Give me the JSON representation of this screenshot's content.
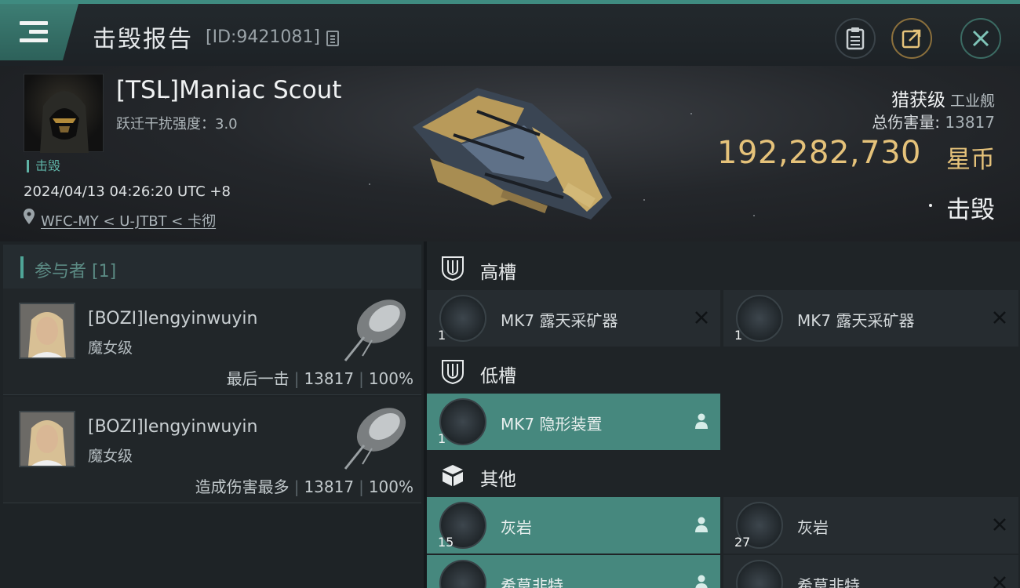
{
  "header": {
    "title": "击毁报告",
    "report_id": "[ID:9421081]"
  },
  "victim": {
    "name": "[TSL]Maniac Scout",
    "warp_disruption": "跃迁干扰强度：3.0",
    "status_tag": "击毁",
    "timestamp": "2024/04/13 04:26:20 UTC +8",
    "location": "WFC-MY < U-JTBT < 卡彻",
    "ship_class": "猎获级",
    "ship_type": "工业舰",
    "total_damage_label": "总伤害量:",
    "total_damage_value": "13817",
    "value": "192,282,730",
    "value_unit": "星币",
    "result": "击毁"
  },
  "participants": {
    "header": "参与者 [1]",
    "rows": [
      {
        "name": "[BOZI]lengyinwuyin",
        "ship": "魔女级",
        "role": "最后一击",
        "damage": "13817",
        "percent": "100%"
      },
      {
        "name": "[BOZI]lengyinwuyin",
        "ship": "魔女级",
        "role": "造成伤害最多",
        "damage": "13817",
        "percent": "100%"
      }
    ]
  },
  "fitting": {
    "high_label": "高槽",
    "low_label": "低槽",
    "other_label": "其他",
    "high": [
      {
        "name": "MK7 露天采矿器",
        "qty": "1",
        "state": "destroyed"
      },
      {
        "name": "MK7 露天采矿器",
        "qty": "1",
        "state": "destroyed"
      }
    ],
    "low": [
      {
        "name": "MK7 隐形装置",
        "qty": "1",
        "state": "dropped"
      }
    ],
    "other": [
      {
        "name": "灰岩",
        "qty": "15",
        "state": "dropped"
      },
      {
        "name": "灰岩",
        "qty": "27",
        "state": "destroyed"
      },
      {
        "name": "希草非特",
        "qty": "",
        "state": "dropped"
      },
      {
        "name": "希草非特",
        "qty": "",
        "state": "destroyed"
      }
    ]
  },
  "colors": {
    "accent": "#46887e",
    "isk_gold": "#e5c27a",
    "background": "#1f2427"
  }
}
